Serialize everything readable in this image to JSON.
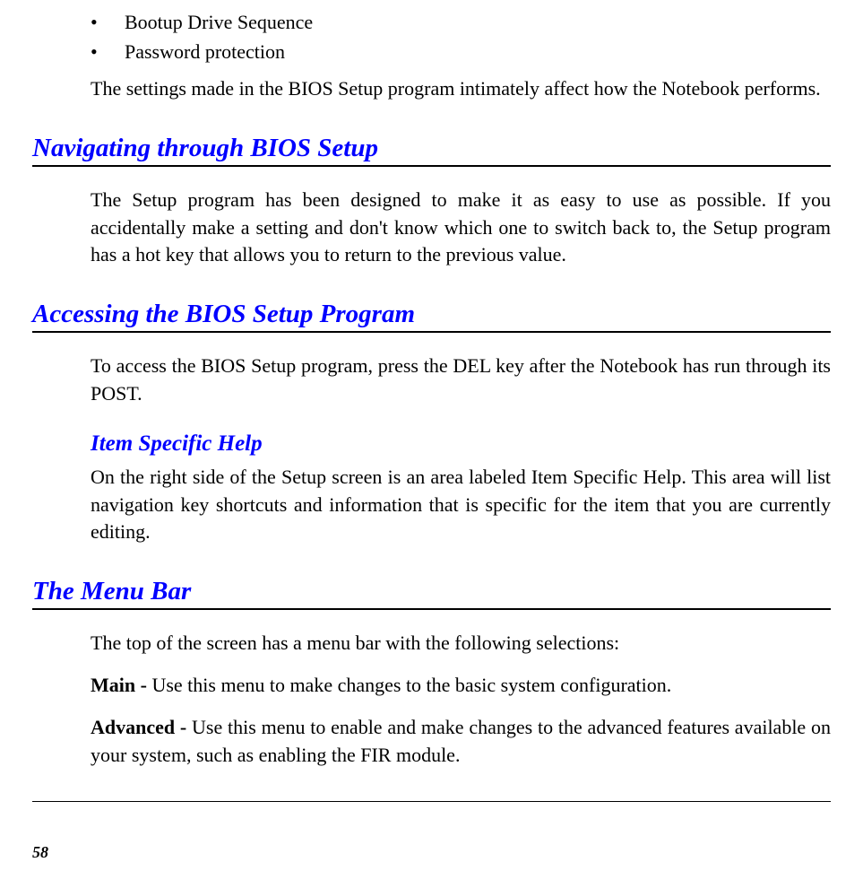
{
  "bullets": {
    "item1": "Bootup Drive Sequence",
    "item2": "Password protection"
  },
  "intro_para": "The settings made in the BIOS Setup program intimately affect how the Notebook performs.",
  "section1": {
    "heading": "Navigating through BIOS Setup",
    "para": "The Setup program has been designed to make it as easy to use as possible.  If you accidentally make a setting and don't know which one to switch back to, the Setup program has a hot key that allows you to return to the previous value."
  },
  "section2": {
    "heading": "Accessing the BIOS Setup Program",
    "para": "To access the BIOS Setup program, press the DEL key after the Notebook has run through its POST.",
    "subheading": "Item Specific Help",
    "subpara": "On the right side of the Setup screen is an area labeled Item Specific Help.  This area will list navigation key shortcuts and information that is specific for the item that you are currently editing."
  },
  "section3": {
    "heading": "The Menu Bar",
    "para": "The top of the screen has a menu bar with the following selections:",
    "main_label": "Main - ",
    "main_text": "Use this menu to make changes to the basic system configuration.",
    "advanced_label": "Advanced - ",
    "advanced_text": "Use this menu to enable and make changes to the advanced features available on your system, such as enabling the FIR module."
  },
  "page_number": "58"
}
